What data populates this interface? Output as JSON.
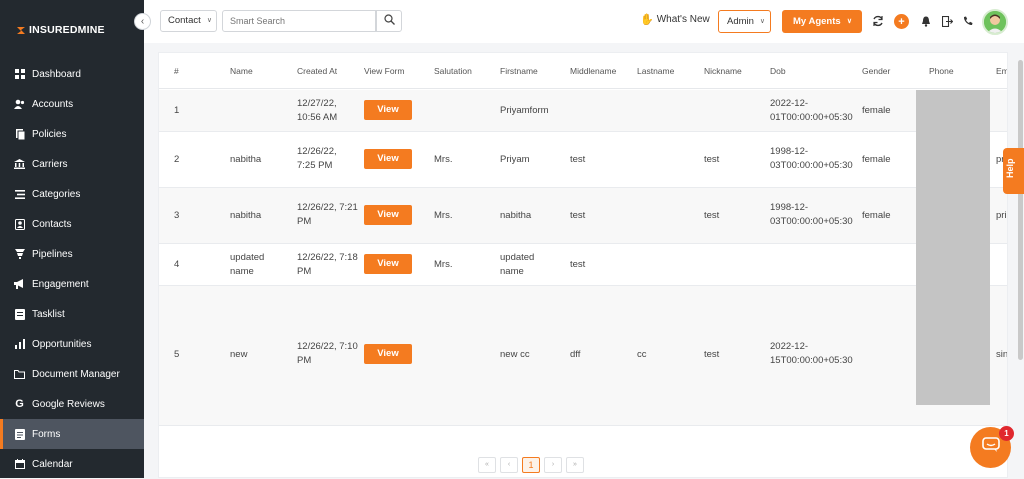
{
  "brand": {
    "name": "INSUREDMINE"
  },
  "sidebar": {
    "items": [
      {
        "label": "Dashboard",
        "icon": "dashboard-icon"
      },
      {
        "label": "Accounts",
        "icon": "accounts-icon"
      },
      {
        "label": "Policies",
        "icon": "policies-icon"
      },
      {
        "label": "Carriers",
        "icon": "carriers-icon"
      },
      {
        "label": "Categories",
        "icon": "categories-icon"
      },
      {
        "label": "Contacts",
        "icon": "contacts-icon"
      },
      {
        "label": "Pipelines",
        "icon": "pipelines-icon"
      },
      {
        "label": "Engagement",
        "icon": "megaphone-icon"
      },
      {
        "label": "Tasklist",
        "icon": "tasklist-icon"
      },
      {
        "label": "Opportunities",
        "icon": "chart-icon"
      },
      {
        "label": "Document Manager",
        "icon": "folder-icon"
      },
      {
        "label": "Google Reviews",
        "icon": "google-icon"
      },
      {
        "label": "Forms",
        "icon": "forms-icon",
        "active": true
      },
      {
        "label": "Calendar",
        "icon": "calendar-icon"
      }
    ]
  },
  "topbar": {
    "search_scope": "Contact",
    "search_placeholder": "Smart Search",
    "whats_new": "What's New",
    "role": "Admin",
    "my_agents": "My Agents"
  },
  "table": {
    "columns": [
      "#",
      "Name",
      "Created At",
      "View Form",
      "Salutation",
      "Firstname",
      "Middlename",
      "Lastname",
      "Nickname",
      "Dob",
      "Gender",
      "Phone",
      "Em"
    ],
    "view_label": "View",
    "rows": [
      {
        "num": "1",
        "name": "",
        "created_1": "12/27/22,",
        "created_2": "10:56 AM",
        "salutation": "",
        "firstname_1": "Priyamform",
        "firstname_2": "",
        "middlename": "",
        "lastname": "",
        "nickname": "",
        "dob_1": "2022-12-",
        "dob_2": "01T00:00:00+05:30",
        "gender": "female",
        "email": ""
      },
      {
        "num": "2",
        "name": "nabitha",
        "created_1": "12/26/22,",
        "created_2": "7:25 PM",
        "salutation": "Mrs.",
        "firstname_1": "Priyam",
        "firstname_2": "",
        "middlename": "test",
        "lastname": "",
        "nickname": "test",
        "dob_1": "1998-12-",
        "dob_2": "03T00:00:00+05:30",
        "gender": "female",
        "email": "pr"
      },
      {
        "num": "3",
        "name": "nabitha",
        "created_1": "12/26/22, 7:21",
        "created_2": "PM",
        "salutation": "Mrs.",
        "firstname_1": "nabitha",
        "firstname_2": "",
        "middlename": "test",
        "lastname": "",
        "nickname": "test",
        "dob_1": "1998-12-",
        "dob_2": "03T00:00:00+05:30",
        "gender": "female",
        "email": "pri"
      },
      {
        "num": "4",
        "name_1": "updated",
        "name_2": "name",
        "created_1": "12/26/22, 7:18",
        "created_2": "PM",
        "salutation": "Mrs.",
        "firstname_1": "updated",
        "firstname_2": "name",
        "middlename": "test",
        "lastname": "",
        "nickname": "",
        "dob_1": "",
        "dob_2": "",
        "gender": "",
        "email": ""
      },
      {
        "num": "5",
        "name": "new",
        "created_1": "12/26/22, 7:10",
        "created_2": "PM",
        "salutation": "",
        "firstname_1": "new cc",
        "firstname_2": "",
        "middlename": "dff",
        "lastname": "cc",
        "nickname": "test",
        "dob_1": "2022-12-",
        "dob_2": "15T00:00:00+05:30",
        "gender": "",
        "email": "sin"
      }
    ]
  },
  "pagination": {
    "first": "«",
    "prev": "‹",
    "current": "1",
    "next": "›",
    "last": "»"
  },
  "help": {
    "label": "Help"
  },
  "chat": {
    "badge": "1"
  },
  "colors": {
    "accent": "#f47b20",
    "sidebar": "#23292f",
    "badge": "#e0282e"
  }
}
